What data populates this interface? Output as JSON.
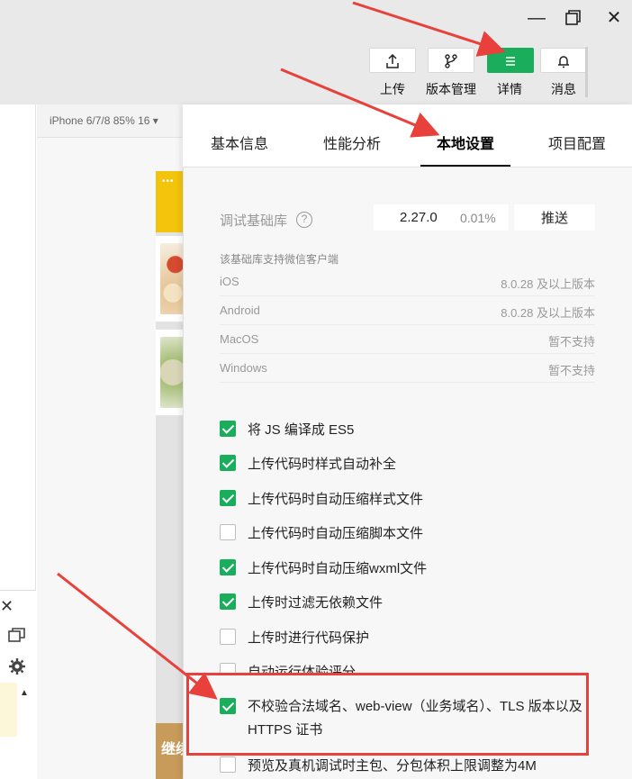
{
  "window": {
    "minimize_icon": "minimize-icon",
    "restore_icon": "restore-icon",
    "close_icon": "close-icon"
  },
  "toolbar": {
    "upload_label": "上传",
    "version_label": "版本管理",
    "details_label": "详情",
    "messages_label": "消息",
    "accent_color": "#1aad5c"
  },
  "simulator": {
    "device_label": "iPhone 6/7/8 85% 16 ▾",
    "dots": "•••",
    "continue_label": "继续"
  },
  "panel": {
    "tabs": [
      {
        "label": "基本信息"
      },
      {
        "label": "性能分析"
      },
      {
        "label": "本地设置",
        "active": true
      },
      {
        "label": "项目配置"
      }
    ],
    "debug_lib_label": "调试基础库",
    "help_glyph": "?",
    "version": "2.27.0",
    "percent": "0.01%",
    "push_label": "推送",
    "support_title": "该基础库支持微信客户端",
    "support": [
      {
        "platform": "iOS",
        "value": "8.0.28 及以上版本"
      },
      {
        "platform": "Android",
        "value": "8.0.28 及以上版本"
      },
      {
        "platform": "MacOS",
        "value": "暂不支持"
      },
      {
        "platform": "Windows",
        "value": "暂不支持"
      }
    ],
    "options": [
      {
        "label": "将 JS 编译成 ES5",
        "checked": true
      },
      {
        "label": "上传代码时样式自动补全",
        "checked": true
      },
      {
        "label": "上传代码时自动压缩样式文件",
        "checked": true
      },
      {
        "label": "上传代码时自动压缩脚本文件",
        "checked": false
      },
      {
        "label": "上传代码时自动压缩wxml文件",
        "checked": true
      },
      {
        "label": "上传时过滤无依赖文件",
        "checked": true
      },
      {
        "label": "上传时进行代码保护",
        "checked": false
      },
      {
        "label": "自动运行体验评分",
        "checked": false
      },
      {
        "label": "不校验合法域名、web-view（业务域名）、TLS 版本以及 HTTPS 证书",
        "checked": true
      },
      {
        "label": "预览及真机调试时主包、分包体积上限调整为4M",
        "checked": false
      }
    ]
  },
  "annotation": {
    "color": "#e8403b"
  }
}
